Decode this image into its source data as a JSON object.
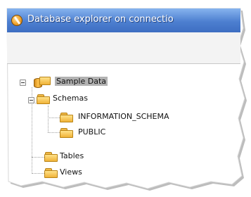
{
  "window": {
    "title": "Database explorer on connectio"
  },
  "tree": {
    "root": {
      "label": "Sample Data",
      "expanded": true,
      "selected": true
    },
    "schemas": {
      "label": "Schemas",
      "expanded": true
    },
    "schema_items": [
      {
        "label": "INFORMATION_SCHEMA"
      },
      {
        "label": "PUBLIC"
      }
    ],
    "tables": {
      "label": "Tables"
    },
    "views": {
      "label": "Views"
    }
  },
  "colors": {
    "titlebar": "#4d7fd0",
    "selection": "#b2b2b2",
    "folder": "#f0b947"
  }
}
